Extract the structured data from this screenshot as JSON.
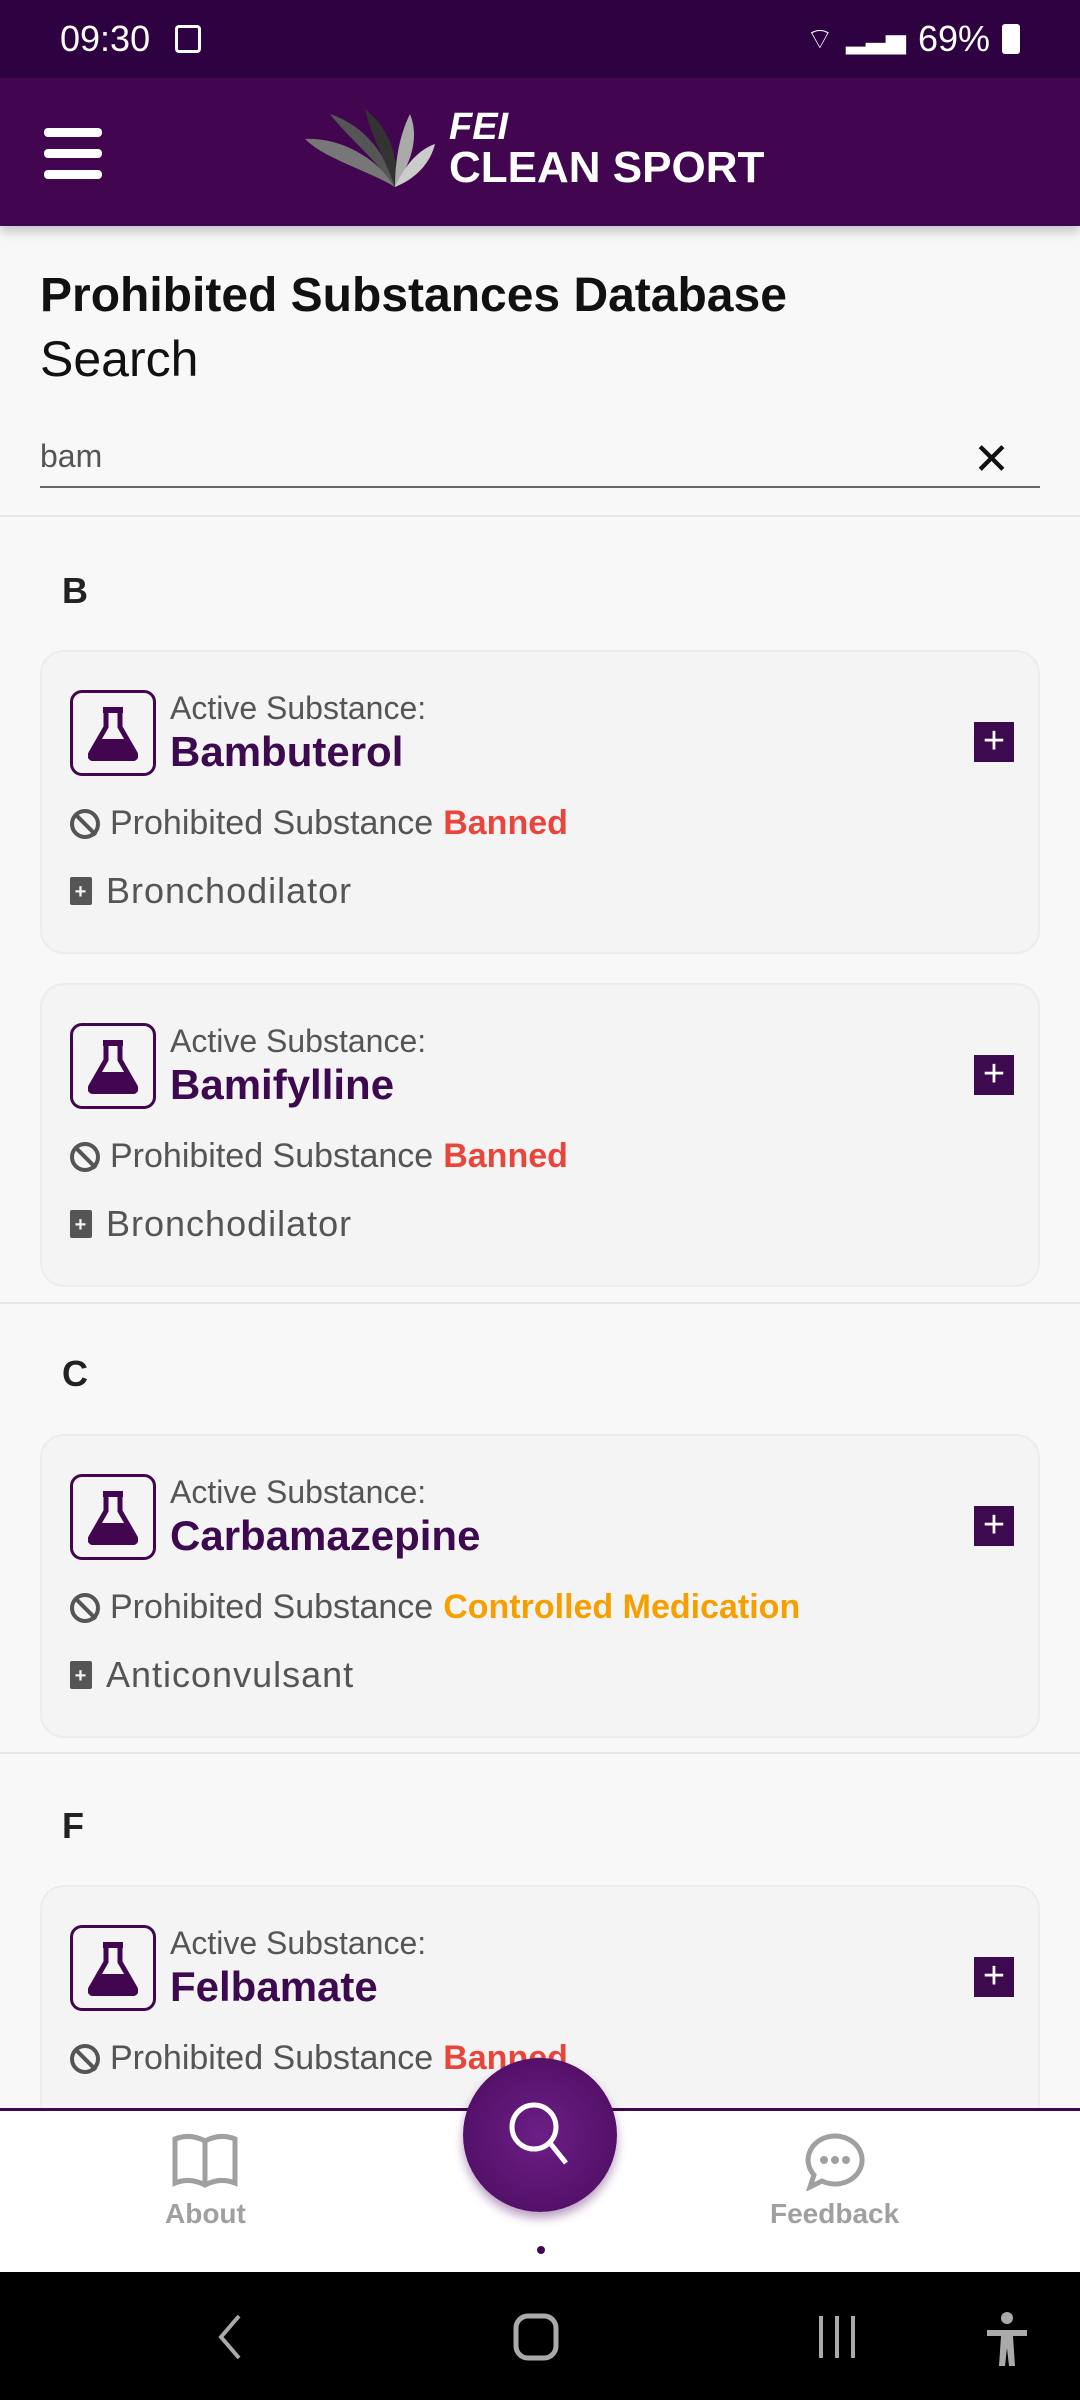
{
  "status_bar": {
    "time": "09:30",
    "battery": "69%"
  },
  "header": {
    "logo_top": "FEI",
    "logo_bottom": "CLEAN SPORT"
  },
  "page": {
    "title": "Prohibited Substances Database",
    "subtitle": "Search"
  },
  "search": {
    "value": "bam"
  },
  "colors": {
    "brand": "#41064f",
    "banned": "#e8453c",
    "controlled": "#f5a000"
  },
  "groups": [
    {
      "letter": "B",
      "items": [
        {
          "label": "Active Substance:",
          "name": "Bambuterol",
          "prohibited": "Prohibited Substance",
          "status": "Banned",
          "category": "Bronchodilator"
        },
        {
          "label": "Active Substance:",
          "name": "Bamifylline",
          "prohibited": "Prohibited Substance",
          "status": "Banned",
          "category": "Bronchodilator"
        }
      ]
    },
    {
      "letter": "C",
      "items": [
        {
          "label": "Active Substance:",
          "name": "Carbamazepine",
          "prohibited": "Prohibited Substance",
          "status": "Controlled Medication",
          "category": "Anticonvulsant"
        }
      ]
    },
    {
      "letter": "F",
      "items": [
        {
          "label": "Active Substance:",
          "name": "Felbamate",
          "prohibited": "Prohibited Substance",
          "status": "Banned",
          "category": ""
        }
      ]
    }
  ],
  "bottom_nav": {
    "about": "About",
    "feedback": "Feedback"
  }
}
